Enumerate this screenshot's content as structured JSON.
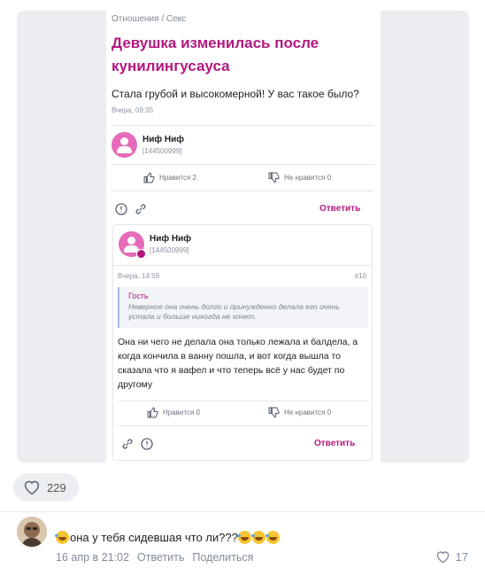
{
  "topic": {
    "breadcrumb": "Отношения / Секс",
    "title": "Девушка изменилась после кунилингусауса",
    "text": "Стала грубой и высокомерной! У вас такое было?",
    "time": "Вчера, 09:35",
    "author": {
      "name": "Ниф Ниф",
      "id": "[144500999]"
    },
    "like_label": "Нравится 2",
    "dislike_label": "Не нравится 0",
    "reply_label": "Ответить"
  },
  "comment": {
    "author": {
      "name": "Ниф Ниф",
      "id": "[144500999]"
    },
    "time": "Вчера, 14:59",
    "number": "#10",
    "quote": {
      "author": "Гость",
      "text": "Неверное она очень долго и принужденно делала его очень устала и больше никогда не хочет."
    },
    "text": "Она ни чего не делала она только лежала и балдела, а когда кончила в ванну пошла, и вот когда вышла то сказала что я вафел и что теперь всё у нас будет по другому",
    "like_label": "Нравится 0",
    "dislike_label": "Не нравится 0",
    "reply_label": "Ответить"
  },
  "post": {
    "likes": "229"
  },
  "user_comment": {
    "text": "она у тебя сидевшая что ли???",
    "date": "16 апр в 21:02",
    "reply_label": "Ответить",
    "share_label": "Поделиться",
    "likes": "17"
  },
  "colors": {
    "accent": "#b3187f",
    "avatar": "#e56bb8",
    "quote_bar": "#a7bde0"
  },
  "icons": [
    "user-avatar-icon",
    "thumb-up-icon",
    "thumb-down-icon",
    "report-icon",
    "link-icon",
    "heart-icon",
    "laughing-emoji-icon"
  ]
}
